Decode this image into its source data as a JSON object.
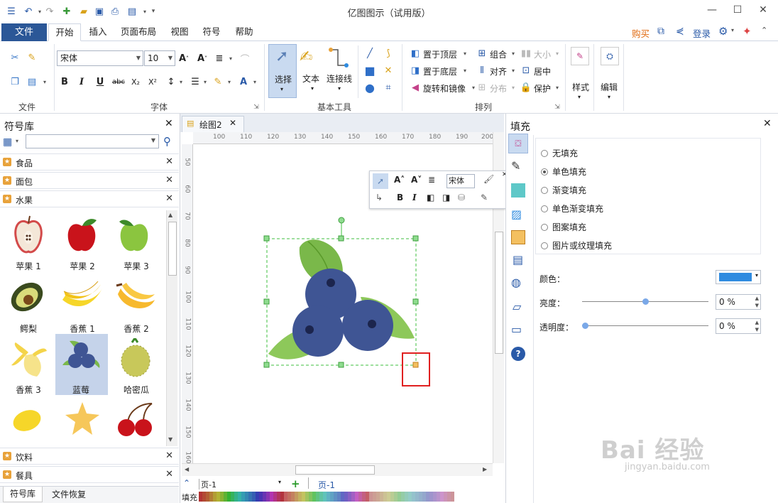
{
  "window": {
    "title": "亿图图示（试用版）",
    "min": "—",
    "max": "☐",
    "close": "✕"
  },
  "menu": {
    "file": "文件",
    "tabs": [
      "开始",
      "插入",
      "页面布局",
      "视图",
      "符号",
      "帮助"
    ],
    "right": {
      "buy": "购买",
      "login": "登录"
    }
  },
  "ribbon": {
    "groups": {
      "file": "文件",
      "font": "字体",
      "basic_tools": "基本工具",
      "arrange": "排列",
      "style": "样式",
      "edit": "编辑"
    },
    "font_name": "宋体",
    "font_size": "10",
    "tools": {
      "select": "选择",
      "text": "文本",
      "connector": "连接线"
    },
    "arrange": {
      "bring_front": "置于顶层",
      "group": "组合",
      "size": "大小",
      "send_back": "置于底层",
      "align": "对齐",
      "center": "居中",
      "rotate": "旋转和镜像",
      "distribute": "分布",
      "protect": "保护"
    }
  },
  "library": {
    "title": "符号库",
    "categories_top": [
      "食品",
      "面包",
      "水果"
    ],
    "symbols": [
      {
        "name": "苹果 1"
      },
      {
        "name": "苹果 2"
      },
      {
        "name": "苹果 3"
      },
      {
        "name": "鳄梨"
      },
      {
        "name": "香蕉 1"
      },
      {
        "name": "香蕉 2"
      },
      {
        "name": "香蕉 3"
      },
      {
        "name": "蓝莓"
      },
      {
        "name": "哈密瓜"
      }
    ],
    "categories_bottom": [
      "饮料",
      "餐具"
    ],
    "bottom_tabs": [
      "符号库",
      "文件恢复"
    ]
  },
  "document": {
    "tab": "绘图2",
    "ruler_h": [
      "100",
      "110",
      "120",
      "130",
      "140",
      "150",
      "160",
      "170",
      "180",
      "190",
      "200"
    ],
    "ruler_v": [
      "50",
      "60",
      "70",
      "80",
      "90",
      "100",
      "110",
      "120",
      "130",
      "140",
      "150",
      "160"
    ],
    "page_combo": "页-1",
    "page_tab": "页-1",
    "fill_label": "填充",
    "mini_font": "宋体"
  },
  "fill_panel": {
    "title": "填充",
    "options": [
      {
        "label": "无填充",
        "checked": false
      },
      {
        "label": "单色填充",
        "checked": true
      },
      {
        "label": "渐变填充",
        "checked": false
      },
      {
        "label": "单色渐变填充",
        "checked": false
      },
      {
        "label": "图案填充",
        "checked": false
      },
      {
        "label": "图片或纹理填充",
        "checked": false
      }
    ],
    "color_label": "颜色：",
    "color_value": "#2f8be0",
    "brightness_label": "亮度：",
    "brightness_value": "0 %",
    "brightness_level": 0.5,
    "transparency_label": "透明度：",
    "transparency_value": "0 %",
    "transparency_level": 0.0
  },
  "watermark": {
    "brand": "Bai 经验",
    "url": "jingyan.baidu.com"
  }
}
